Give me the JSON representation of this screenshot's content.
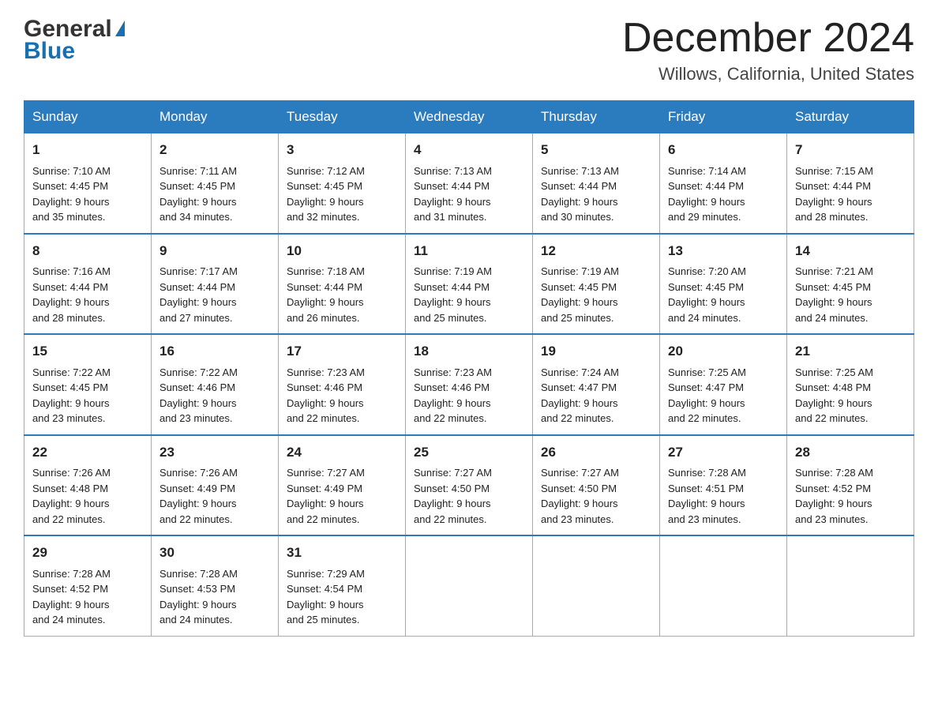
{
  "header": {
    "logo_general": "General",
    "logo_blue": "Blue",
    "title": "December 2024",
    "location": "Willows, California, United States"
  },
  "days_of_week": [
    "Sunday",
    "Monday",
    "Tuesday",
    "Wednesday",
    "Thursday",
    "Friday",
    "Saturday"
  ],
  "weeks": [
    [
      {
        "day": "1",
        "sunrise": "7:10 AM",
        "sunset": "4:45 PM",
        "daylight": "9 hours and 35 minutes."
      },
      {
        "day": "2",
        "sunrise": "7:11 AM",
        "sunset": "4:45 PM",
        "daylight": "9 hours and 34 minutes."
      },
      {
        "day": "3",
        "sunrise": "7:12 AM",
        "sunset": "4:45 PM",
        "daylight": "9 hours and 32 minutes."
      },
      {
        "day": "4",
        "sunrise": "7:13 AM",
        "sunset": "4:44 PM",
        "daylight": "9 hours and 31 minutes."
      },
      {
        "day": "5",
        "sunrise": "7:13 AM",
        "sunset": "4:44 PM",
        "daylight": "9 hours and 30 minutes."
      },
      {
        "day": "6",
        "sunrise": "7:14 AM",
        "sunset": "4:44 PM",
        "daylight": "9 hours and 29 minutes."
      },
      {
        "day": "7",
        "sunrise": "7:15 AM",
        "sunset": "4:44 PM",
        "daylight": "9 hours and 28 minutes."
      }
    ],
    [
      {
        "day": "8",
        "sunrise": "7:16 AM",
        "sunset": "4:44 PM",
        "daylight": "9 hours and 28 minutes."
      },
      {
        "day": "9",
        "sunrise": "7:17 AM",
        "sunset": "4:44 PM",
        "daylight": "9 hours and 27 minutes."
      },
      {
        "day": "10",
        "sunrise": "7:18 AM",
        "sunset": "4:44 PM",
        "daylight": "9 hours and 26 minutes."
      },
      {
        "day": "11",
        "sunrise": "7:19 AM",
        "sunset": "4:44 PM",
        "daylight": "9 hours and 25 minutes."
      },
      {
        "day": "12",
        "sunrise": "7:19 AM",
        "sunset": "4:45 PM",
        "daylight": "9 hours and 25 minutes."
      },
      {
        "day": "13",
        "sunrise": "7:20 AM",
        "sunset": "4:45 PM",
        "daylight": "9 hours and 24 minutes."
      },
      {
        "day": "14",
        "sunrise": "7:21 AM",
        "sunset": "4:45 PM",
        "daylight": "9 hours and 24 minutes."
      }
    ],
    [
      {
        "day": "15",
        "sunrise": "7:22 AM",
        "sunset": "4:45 PM",
        "daylight": "9 hours and 23 minutes."
      },
      {
        "day": "16",
        "sunrise": "7:22 AM",
        "sunset": "4:46 PM",
        "daylight": "9 hours and 23 minutes."
      },
      {
        "day": "17",
        "sunrise": "7:23 AM",
        "sunset": "4:46 PM",
        "daylight": "9 hours and 22 minutes."
      },
      {
        "day": "18",
        "sunrise": "7:23 AM",
        "sunset": "4:46 PM",
        "daylight": "9 hours and 22 minutes."
      },
      {
        "day": "19",
        "sunrise": "7:24 AM",
        "sunset": "4:47 PM",
        "daylight": "9 hours and 22 minutes."
      },
      {
        "day": "20",
        "sunrise": "7:25 AM",
        "sunset": "4:47 PM",
        "daylight": "9 hours and 22 minutes."
      },
      {
        "day": "21",
        "sunrise": "7:25 AM",
        "sunset": "4:48 PM",
        "daylight": "9 hours and 22 minutes."
      }
    ],
    [
      {
        "day": "22",
        "sunrise": "7:26 AM",
        "sunset": "4:48 PM",
        "daylight": "9 hours and 22 minutes."
      },
      {
        "day": "23",
        "sunrise": "7:26 AM",
        "sunset": "4:49 PM",
        "daylight": "9 hours and 22 minutes."
      },
      {
        "day": "24",
        "sunrise": "7:27 AM",
        "sunset": "4:49 PM",
        "daylight": "9 hours and 22 minutes."
      },
      {
        "day": "25",
        "sunrise": "7:27 AM",
        "sunset": "4:50 PM",
        "daylight": "9 hours and 22 minutes."
      },
      {
        "day": "26",
        "sunrise": "7:27 AM",
        "sunset": "4:50 PM",
        "daylight": "9 hours and 23 minutes."
      },
      {
        "day": "27",
        "sunrise": "7:28 AM",
        "sunset": "4:51 PM",
        "daylight": "9 hours and 23 minutes."
      },
      {
        "day": "28",
        "sunrise": "7:28 AM",
        "sunset": "4:52 PM",
        "daylight": "9 hours and 23 minutes."
      }
    ],
    [
      {
        "day": "29",
        "sunrise": "7:28 AM",
        "sunset": "4:52 PM",
        "daylight": "9 hours and 24 minutes."
      },
      {
        "day": "30",
        "sunrise": "7:28 AM",
        "sunset": "4:53 PM",
        "daylight": "9 hours and 24 minutes."
      },
      {
        "day": "31",
        "sunrise": "7:29 AM",
        "sunset": "4:54 PM",
        "daylight": "9 hours and 25 minutes."
      },
      null,
      null,
      null,
      null
    ]
  ],
  "labels": {
    "sunrise": "Sunrise:",
    "sunset": "Sunset:",
    "daylight": "Daylight:"
  }
}
